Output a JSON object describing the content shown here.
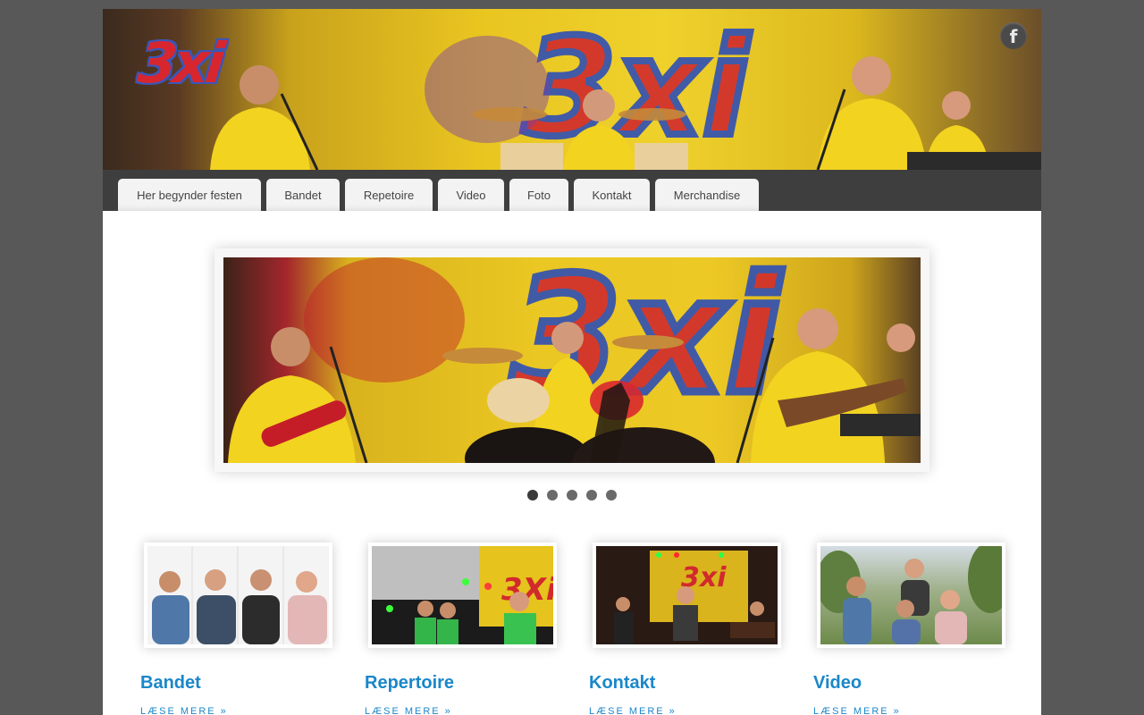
{
  "header": {
    "logo_text": "3xi",
    "facebook_icon": "facebook-icon"
  },
  "nav": {
    "items": [
      {
        "label": "Her begynder festen"
      },
      {
        "label": "Bandet"
      },
      {
        "label": "Repetoire"
      },
      {
        "label": "Video"
      },
      {
        "label": "Foto"
      },
      {
        "label": "Kontakt"
      },
      {
        "label": "Merchandise"
      }
    ]
  },
  "slider": {
    "slide_count": 5,
    "active_index": 0
  },
  "features": [
    {
      "title": "Bandet",
      "link": "LÆSE MERE »"
    },
    {
      "title": "Repertoire",
      "link": "LÆSE MERE »"
    },
    {
      "title": "Kontakt",
      "link": "LÆSE MERE »"
    },
    {
      "title": "Video",
      "link": "LÆSE MERE »"
    }
  ],
  "colors": {
    "page_bg": "#585858",
    "nav_bg": "#3e3e3e",
    "link": "#1a87c9",
    "shirt_yellow": "#f2d320"
  }
}
